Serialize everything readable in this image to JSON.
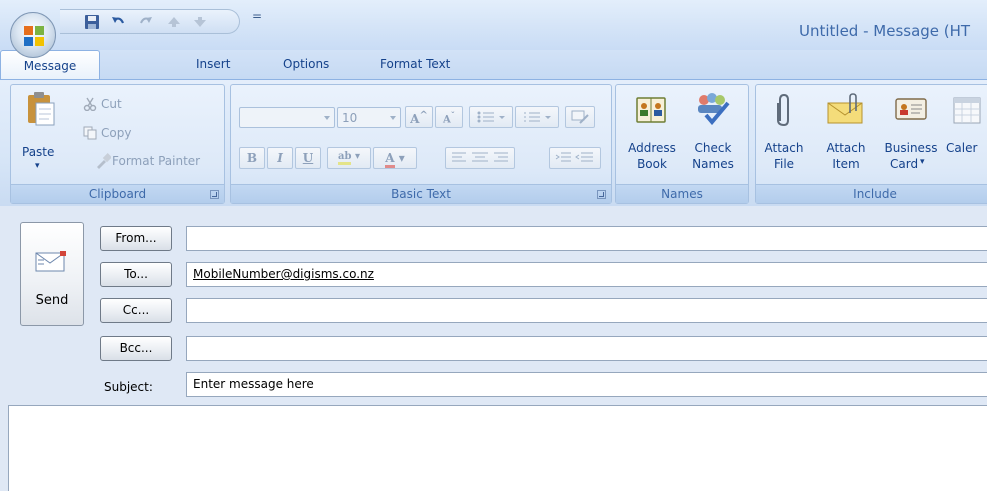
{
  "window": {
    "title": "Untitled - Message (HT"
  },
  "quick_access": {
    "icons": [
      "save-icon",
      "undo-icon",
      "redo-icon",
      "previous-item-icon",
      "next-item-icon"
    ],
    "more_glyph": "="
  },
  "tabs": [
    {
      "label": "Message",
      "active": true
    },
    {
      "label": "Insert"
    },
    {
      "label": "Options"
    },
    {
      "label": "Format Text"
    }
  ],
  "ribbon": {
    "clipboard": {
      "label": "Clipboard",
      "paste": "Paste",
      "cut": "Cut",
      "copy": "Copy",
      "format_painter": "Format Painter"
    },
    "basic_text": {
      "label": "Basic Text",
      "font_size": "10",
      "grow_font": "A",
      "shrink_font": "A",
      "bold": "B",
      "italic": "I",
      "underline": "U",
      "highlight": "ab",
      "font_color": "A"
    },
    "names": {
      "label": "Names",
      "address_book_1": "Address",
      "address_book_2": "Book",
      "check_names_1": "Check",
      "check_names_2": "Names"
    },
    "include": {
      "label": "Include",
      "attach_file_1": "Attach",
      "attach_file_2": "File",
      "attach_item_1": "Attach",
      "attach_item_2": "Item",
      "business_card_1": "Business",
      "business_card_2": "Card",
      "calendar_1": "Caler"
    }
  },
  "form": {
    "send": "Send",
    "from": {
      "button": "From...",
      "value": ""
    },
    "to": {
      "button": "To...",
      "value": "MobileNumber@digisms.co.nz"
    },
    "cc": {
      "button": "Cc...",
      "value": ""
    },
    "bcc": {
      "button": "Bcc...",
      "value": ""
    },
    "subject": {
      "label": "Subject:",
      "value": "Enter message here"
    },
    "body": ""
  },
  "colors": {
    "ribbon_text": "#15428b",
    "title_text": "#3e6aaa",
    "ribbon_bg": "#dde9f8",
    "form_bg": "#dfe8f5"
  }
}
